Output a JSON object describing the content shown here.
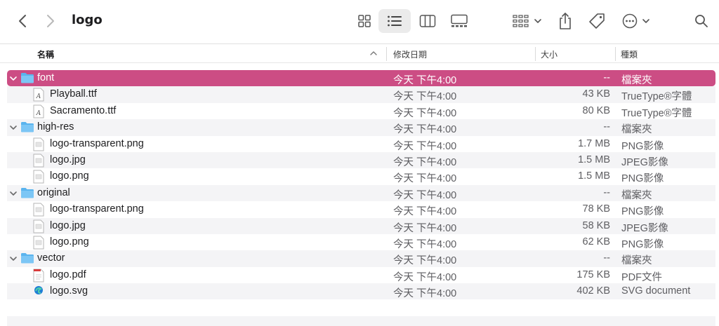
{
  "window": {
    "title": "logo"
  },
  "toolbar": {
    "back": "chevron-left-icon",
    "forward": "chevron-right-icon",
    "views": [
      "icon-view-icon",
      "list-view-icon",
      "column-view-icon",
      "gallery-view-icon"
    ],
    "active_view": "list"
  },
  "columns": {
    "name": "名稱",
    "date": "修改日期",
    "size": "大小",
    "kind": "種類"
  },
  "colors": {
    "selection": "#cc4d84",
    "folder": "#5ab4ee"
  },
  "rows": [
    {
      "name": "font",
      "type": "folder",
      "date": "今天 下午4:00",
      "size": "--",
      "kind": "檔案夾",
      "selected": true
    },
    {
      "name": "Playball.ttf",
      "type": "font",
      "date": "今天 下午4:00",
      "size": "43 KB",
      "kind": "TrueType®字體"
    },
    {
      "name": "Sacramento.ttf",
      "type": "font",
      "date": "今天 下午4:00",
      "size": "80 KB",
      "kind": "TrueType®字體"
    },
    {
      "name": "high-res",
      "type": "folder",
      "date": "今天 下午4:00",
      "size": "--",
      "kind": "檔案夾"
    },
    {
      "name": "logo-transparent.png",
      "type": "image",
      "date": "今天 下午4:00",
      "size": "1.7 MB",
      "kind": "PNG影像"
    },
    {
      "name": "logo.jpg",
      "type": "image",
      "date": "今天 下午4:00",
      "size": "1.5 MB",
      "kind": "JPEG影像"
    },
    {
      "name": "logo.png",
      "type": "image",
      "date": "今天 下午4:00",
      "size": "1.5 MB",
      "kind": "PNG影像"
    },
    {
      "name": "original",
      "type": "folder",
      "date": "今天 下午4:00",
      "size": "--",
      "kind": "檔案夾"
    },
    {
      "name": "logo-transparent.png",
      "type": "image",
      "date": "今天 下午4:00",
      "size": "78 KB",
      "kind": "PNG影像"
    },
    {
      "name": "logo.jpg",
      "type": "image",
      "date": "今天 下午4:00",
      "size": "58 KB",
      "kind": "JPEG影像"
    },
    {
      "name": "logo.png",
      "type": "image",
      "date": "今天 下午4:00",
      "size": "62 KB",
      "kind": "PNG影像"
    },
    {
      "name": "vector",
      "type": "folder",
      "date": "今天 下午4:00",
      "size": "--",
      "kind": "檔案夾"
    },
    {
      "name": "logo.pdf",
      "type": "pdf",
      "date": "今天 下午4:00",
      "size": "175 KB",
      "kind": "PDF文件"
    },
    {
      "name": "logo.svg",
      "type": "svg",
      "date": "今天 下午4:00",
      "size": "402 KB",
      "kind": "SVG document"
    }
  ]
}
